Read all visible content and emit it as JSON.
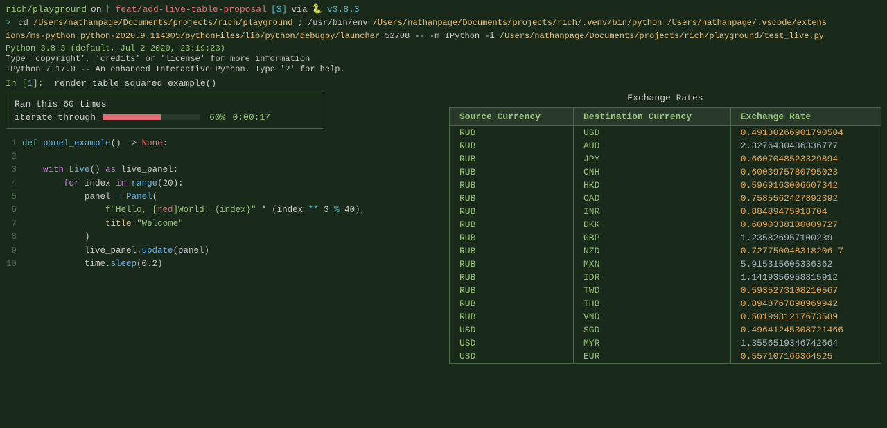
{
  "terminal": {
    "topbar": {
      "dir": "rich/playground",
      "on": "on",
      "branch": "feat/add-live-table-proposal",
      "dollar": "[$]",
      "via": "via",
      "python_icon": "🐍",
      "version": "v3.8.3"
    },
    "cmd1_arrow": ">",
    "cmd1": "cd /Users/nathanpage/Documents/projects/rich/playground ; /usr/bin/env /Users/nathanpage/Documents/projects/rich/.venv/bin/python /Users/nathanpage/.vscode/extensions/ms-python.python-2020.9.114305/pythonFiles/lib/python/debugpy/launcher 52708 -- -m IPython -i /Users/nathanpage/Documents/projects/rich/playground/test_live.py",
    "info1": "Python 3.8.3 (default, Jul  2 2020, 23:19:23)",
    "info2": "Type 'copyright', 'credits' or 'license' for more information",
    "info3": "IPython 7.17.0 -- An enhanced Interactive Python. Type '?' for help.",
    "in_prompt": "In [1]:",
    "in_func": "render_table_squared_example()",
    "progress": {
      "ran_label": "Ran this 60 times",
      "iterate_label": "iterate through",
      "percent": "60%",
      "time": "0:00:17"
    },
    "code": [
      {
        "num": "1",
        "content": "def panel_example() -> None:"
      },
      {
        "num": "2",
        "content": ""
      },
      {
        "num": "3",
        "content": "    with Live() as live_panel:"
      },
      {
        "num": "4",
        "content": "        for index in range(20):"
      },
      {
        "num": "5",
        "content": "            panel = Panel("
      },
      {
        "num": "6",
        "content": "                f\"Hello, [red]World! {index}\" * (index ** 3 % 40),"
      },
      {
        "num": "7",
        "content": "                title=\"Welcome\""
      },
      {
        "num": "8",
        "content": "            )"
      },
      {
        "num": "9",
        "content": "            live_panel.update(panel)"
      },
      {
        "num": "10",
        "content": "            time.sleep(0.2)"
      }
    ]
  },
  "table": {
    "title": "Exchange Rates",
    "headers": [
      "Source Currency",
      "Destination Currency",
      "Exchange Rate"
    ],
    "rows": [
      {
        "source": "RUB",
        "dest": "USD",
        "rate": "0.49130266901790504",
        "rateColor": "orange"
      },
      {
        "source": "RUB",
        "dest": "AUD",
        "rate": "2.3276430436336777",
        "rateColor": "white"
      },
      {
        "source": "RUB",
        "dest": "JPY",
        "rate": "0.6607048523329894",
        "rateColor": "orange"
      },
      {
        "source": "RUB",
        "dest": "CNH",
        "rate": "0.6003975780795023",
        "rateColor": "orange"
      },
      {
        "source": "RUB",
        "dest": "HKD",
        "rate": "0.5969163006607342",
        "rateColor": "orange"
      },
      {
        "source": "RUB",
        "dest": "CAD",
        "rate": "0.7585562427892392",
        "rateColor": "orange"
      },
      {
        "source": "RUB",
        "dest": "INR",
        "rate": "0.88489475918704",
        "rateColor": "orange"
      },
      {
        "source": "RUB",
        "dest": "DKK",
        "rate": "0.6090338180009727",
        "rateColor": "orange"
      },
      {
        "source": "RUB",
        "dest": "GBP",
        "rate": "1.235826957100239",
        "rateColor": "white"
      },
      {
        "source": "RUB",
        "dest": "NZD",
        "rate": "0.727750048318206 7",
        "rateColor": "orange"
      },
      {
        "source": "RUB",
        "dest": "MXN",
        "rate": "5.915315605336362",
        "rateColor": "white"
      },
      {
        "source": "RUB",
        "dest": "IDR",
        "rate": "1.1419356958815912",
        "rateColor": "white"
      },
      {
        "source": "RUB",
        "dest": "TWD",
        "rate": "0.5935273108210567",
        "rateColor": "orange"
      },
      {
        "source": "RUB",
        "dest": "THB",
        "rate": "0.8948767898969942",
        "rateColor": "orange"
      },
      {
        "source": "RUB",
        "dest": "VND",
        "rate": "0.5019931217673589",
        "rateColor": "orange"
      },
      {
        "source": "USD",
        "dest": "SGD",
        "rate": "0.49641245308721466",
        "rateColor": "orange"
      },
      {
        "source": "USD",
        "dest": "MYR",
        "rate": "1.3556519346742664",
        "rateColor": "white"
      },
      {
        "source": "USD",
        "dest": "EUR",
        "rate": "0.557107166364525",
        "rateColor": "orange"
      }
    ]
  }
}
